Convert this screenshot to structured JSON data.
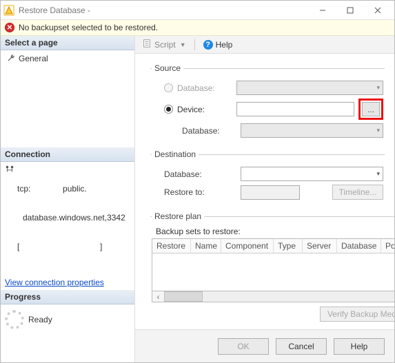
{
  "titlebar": {
    "title": "Restore Database -"
  },
  "alert": {
    "text": "No backupset selected to be restored."
  },
  "leftpanel": {
    "select_page_header": "Select a page",
    "nav_general": "General",
    "connection_header": "Connection",
    "conn_line1": "tcp:              public.",
    "conn_line2": "database.windows.net,3342",
    "conn_line3": "[                                   ]",
    "view_conn_link": "View connection properties",
    "progress_header": "Progress",
    "progress_status": "Ready"
  },
  "toolbar": {
    "script_label": "Script",
    "help_label": "Help"
  },
  "source": {
    "legend": "Source",
    "database_radio": "Database:",
    "device_radio": "Device:",
    "database_sub": "Database:",
    "browse_label": "..."
  },
  "destination": {
    "legend": "Destination",
    "database_label": "Database:",
    "restore_to_label": "Restore to:",
    "timeline_btn": "Timeline..."
  },
  "restoreplan": {
    "legend": "Restore plan",
    "subtitle": "Backup sets to restore:",
    "cols": {
      "restore": "Restore",
      "name": "Name",
      "component": "Component",
      "type": "Type",
      "server": "Server",
      "database": "Database",
      "positi": "Positi"
    },
    "verify_btn": "Verify Backup Media"
  },
  "footer": {
    "ok": "OK",
    "cancel": "Cancel",
    "help": "Help"
  }
}
